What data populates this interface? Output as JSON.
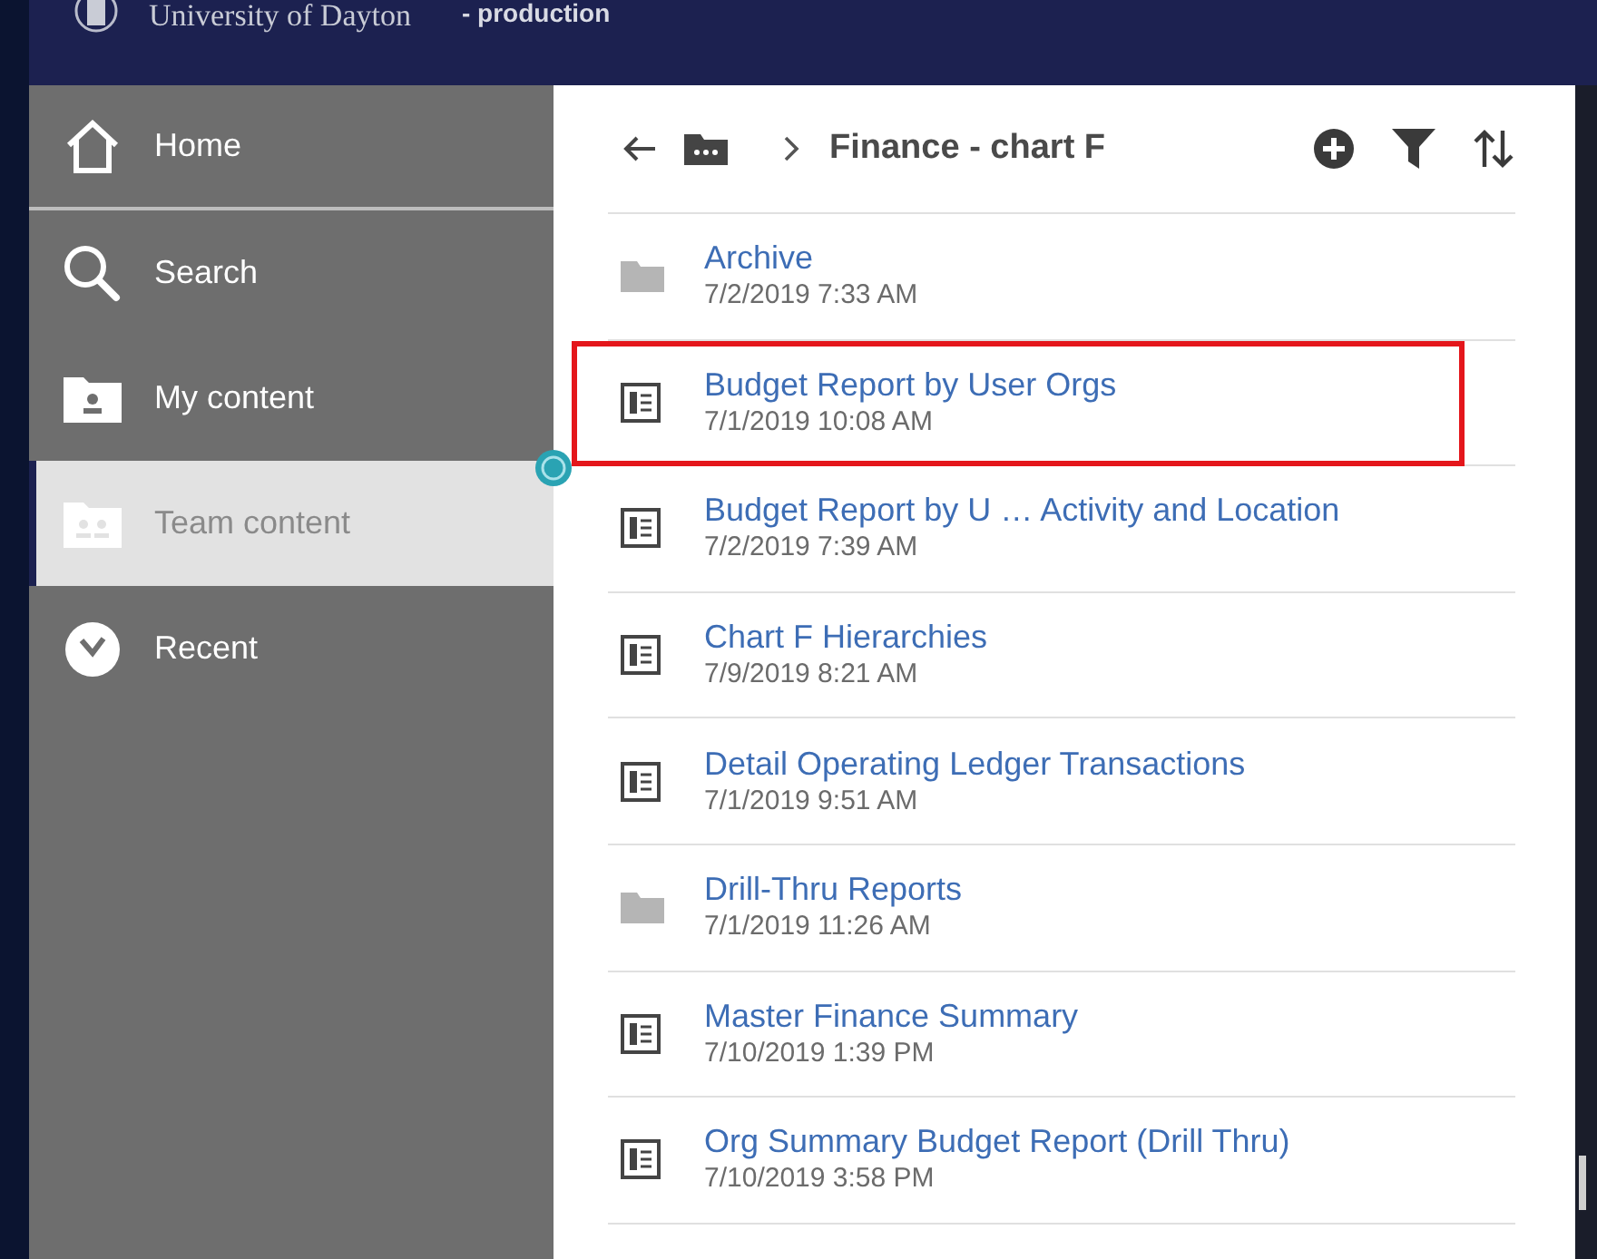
{
  "header": {
    "title": "University of Dayton",
    "environment": "- production"
  },
  "sidebar": {
    "items": [
      {
        "label": "Home",
        "selected": false
      },
      {
        "label": "Search",
        "selected": false
      },
      {
        "label": "My content",
        "selected": false
      },
      {
        "label": "Team content",
        "selected": true
      },
      {
        "label": "Recent",
        "selected": false
      }
    ]
  },
  "toolbar": {
    "breadcrumb": "Finance - chart F"
  },
  "items": [
    {
      "kind": "folder",
      "name": "Archive",
      "date": "7/2/2019 7:33 AM",
      "highlighted": false
    },
    {
      "kind": "report",
      "name": "Budget Report by User Orgs",
      "date": "7/1/2019 10:08 AM",
      "highlighted": true
    },
    {
      "kind": "report",
      "name": "Budget Report by U … Activity and Location",
      "date": "7/2/2019 7:39 AM",
      "highlighted": false
    },
    {
      "kind": "report",
      "name": "Chart F Hierarchies",
      "date": "7/9/2019 8:21 AM",
      "highlighted": false
    },
    {
      "kind": "report",
      "name": "Detail Operating Ledger Transactions",
      "date": "7/1/2019 9:51 AM",
      "highlighted": false
    },
    {
      "kind": "folder",
      "name": "Drill-Thru Reports",
      "date": "7/1/2019 11:26 AM",
      "highlighted": false
    },
    {
      "kind": "report",
      "name": "Master Finance Summary",
      "date": "7/10/2019 1:39 PM",
      "highlighted": false
    },
    {
      "kind": "report",
      "name": "Org Summary Budget Report (Drill Thru)",
      "date": "7/10/2019 3:58 PM",
      "highlighted": false
    }
  ]
}
